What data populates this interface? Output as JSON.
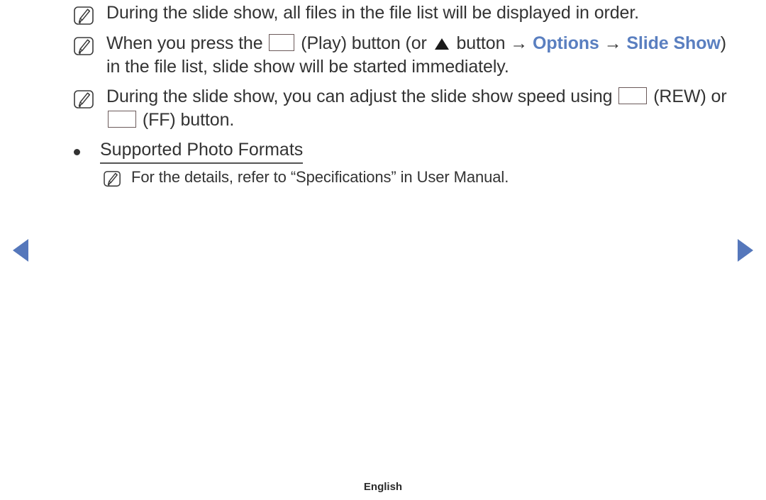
{
  "document": {
    "language_footer": "English",
    "accent_blue": "#5a7fc0",
    "text_color": "#333333",
    "nav_arrow_color": "#5577bb",
    "background": "#ffffff"
  },
  "notes": [
    {
      "icon": "note-pencil-icon",
      "segments": [
        {
          "type": "text",
          "value": "During the slide show, all files in the file list will be displayed in order."
        }
      ]
    },
    {
      "icon": "note-pencil-icon",
      "segments": [
        {
          "type": "text",
          "value": "When you press the "
        },
        {
          "type": "key",
          "value": "play-button-icon"
        },
        {
          "type": "text",
          "value": " (Play) button (or "
        },
        {
          "type": "key",
          "value": "up-arrow-icon"
        },
        {
          "type": "text",
          "value": " button "
        },
        {
          "type": "arrow",
          "value": "→"
        },
        {
          "type": "menu",
          "value": "Options"
        },
        {
          "type": "arrow",
          "value": "→"
        },
        {
          "type": "menu",
          "value": "Slide Show"
        },
        {
          "type": "text",
          "value": ") in the file list, slide show will be started immediately."
        }
      ]
    },
    {
      "icon": "note-pencil-icon",
      "segments": [
        {
          "type": "text",
          "value": "During the slide show, you can adjust the slide show speed using "
        },
        {
          "type": "key",
          "value": "rewind-button-icon"
        },
        {
          "type": "text",
          "value": " (REW) or "
        },
        {
          "type": "key",
          "value": "fast-forward-button-icon"
        },
        {
          "type": "text",
          "value": " (FF) button."
        }
      ]
    }
  ],
  "bullet_item": {
    "label": "Supported Photo Formats",
    "underlined": true
  },
  "sub_note": {
    "icon": "note-pencil-icon",
    "text": "For the details, refer to “Specifications” in User Manual."
  },
  "navigation": {
    "prev_label": "previous-page",
    "next_label": "next-page"
  },
  "line_text": {
    "note1": "During the slide show, all files in the file list will be displayed in order.",
    "note2_a": "When you press the ",
    "note2_b": " (Play) button (or ",
    "note2_c": " button ",
    "note2_arrow1": "→",
    "note2_options": "Options",
    "note2_arrow2": "→",
    "note2_slideshow": "Slide Show",
    "note2_d": ") in the file list, slide show will be started immediately.",
    "note3_a": "During the slide show, you can adjust the slide show speed using ",
    "note3_b": " (REW) or ",
    "note3_c": " (FF) button.",
    "bullet": "Supported Photo Formats",
    "subnote": "For the details, refer to “Specifications” in User Manual.",
    "footer": "English"
  }
}
